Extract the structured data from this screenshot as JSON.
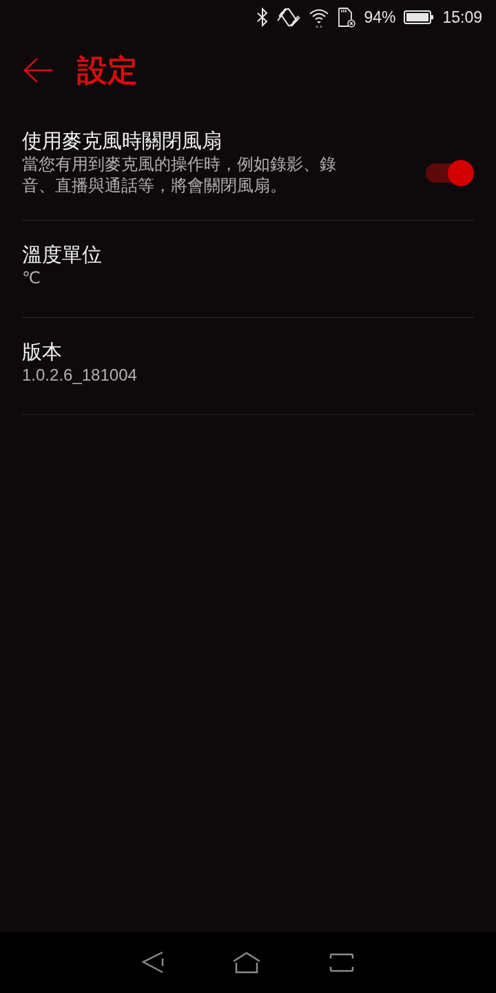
{
  "status_bar": {
    "battery_percent": "94%",
    "time": "15:09"
  },
  "header": {
    "title": "設定"
  },
  "settings": [
    {
      "kind": "toggle",
      "title": "使用麥克風時關閉風扇",
      "summary": "當您有用到麥克風的操作時，例如錄影、錄音、直播與通話等，將會關閉風扇。",
      "on": true
    },
    {
      "kind": "value",
      "title": "溫度單位",
      "summary": "℃"
    },
    {
      "kind": "value",
      "title": "版本",
      "summary": "1.0.2.6_181004"
    }
  ]
}
